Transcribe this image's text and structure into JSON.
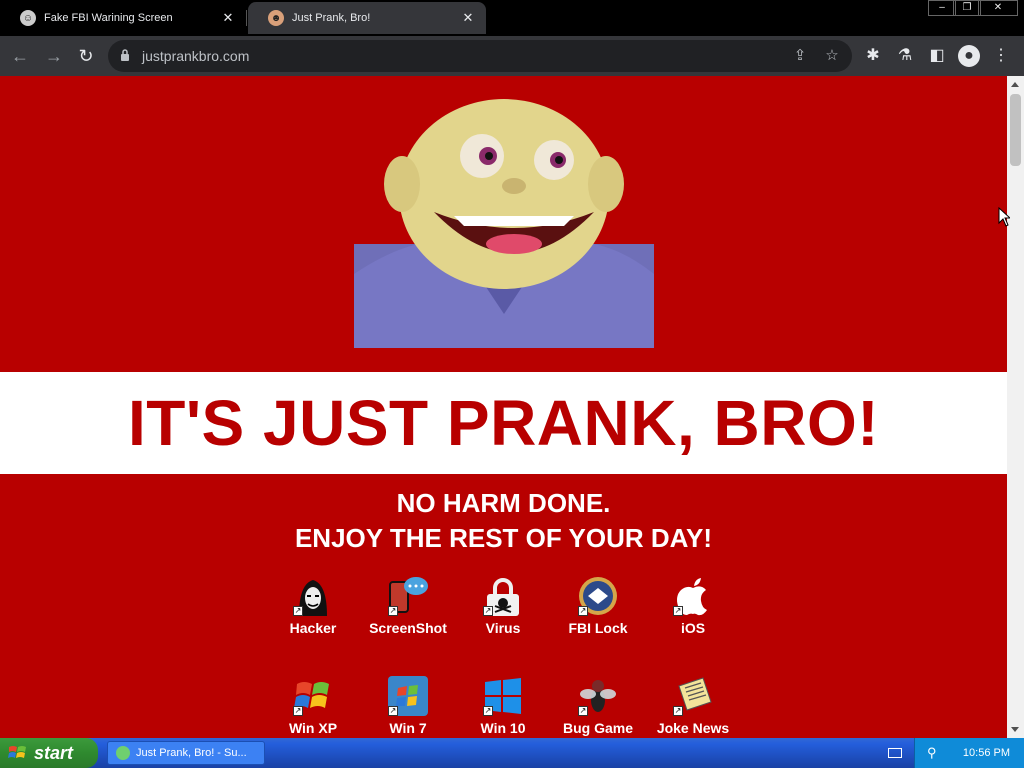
{
  "tabs": [
    {
      "title": "Fake FBI Warining Screen"
    },
    {
      "title": "Just Prank, Bro!"
    }
  ],
  "toolbar": {
    "url": "justprankbro.com"
  },
  "page": {
    "headline": "IT'S JUST PRANK, BRO!",
    "line1": "NO HARM DONE.",
    "line2": "ENJOY THE REST OF YOUR DAY!",
    "icons": [
      {
        "label": "Hacker"
      },
      {
        "label": "ScreenShot"
      },
      {
        "label": "Virus"
      },
      {
        "label": "FBI Lock"
      },
      {
        "label": "iOS"
      },
      {
        "label": "Win XP"
      },
      {
        "label": "Win 7"
      },
      {
        "label": "Win 10"
      },
      {
        "label": "Bug Game"
      },
      {
        "label": "Joke News"
      }
    ]
  },
  "taskbar": {
    "start_label": "start",
    "task_label": "Just Prank, Bro! - Su...",
    "clock": "10:56 PM"
  },
  "colors": {
    "page_red": "#b80000",
    "banner_white": "#ffffff",
    "taskbar_blue": "#245edb",
    "start_green": "#2f8a2f"
  }
}
